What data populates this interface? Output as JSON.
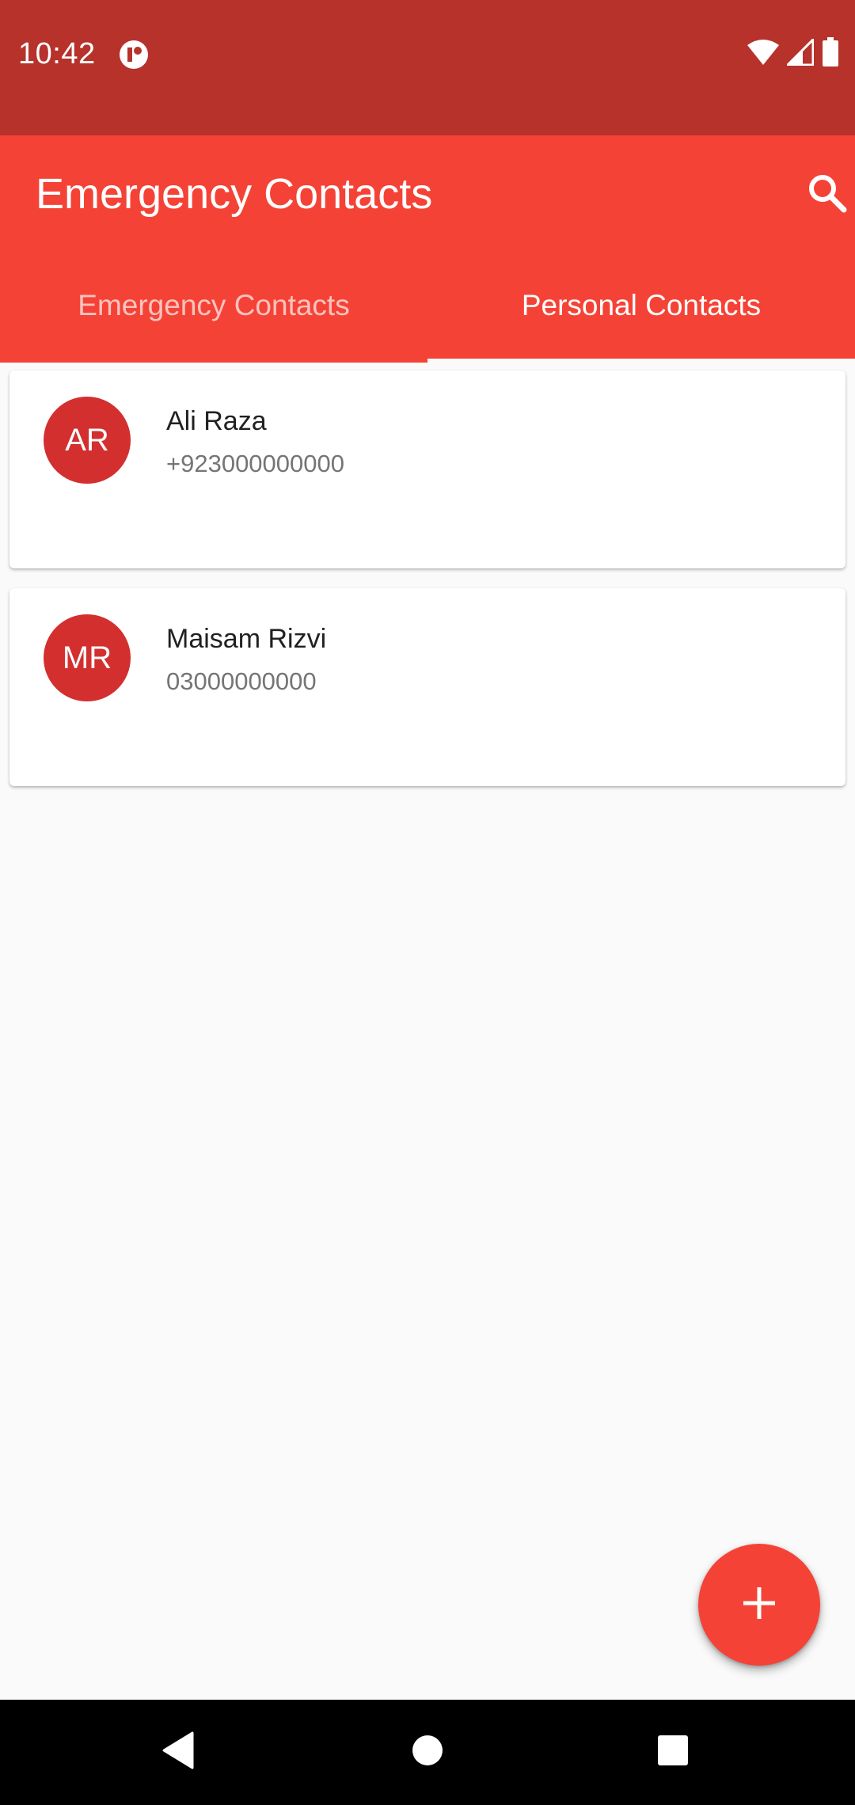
{
  "status_bar": {
    "time": "10:42",
    "icons": [
      "app-notification-icon",
      "wifi-icon",
      "signal-icon",
      "battery-icon"
    ]
  },
  "app_bar": {
    "title": "Emergency Contacts",
    "search_icon": "search-icon"
  },
  "tabs": [
    {
      "label": "Emergency Contacts",
      "active": false
    },
    {
      "label": "Personal Contacts",
      "active": true
    }
  ],
  "contacts": [
    {
      "initials": "AR",
      "name": "Ali Raza",
      "phone": "+923000000000"
    },
    {
      "initials": "MR",
      "name": "Maisam Rizvi",
      "phone": "03000000000"
    }
  ],
  "fab": {
    "icon": "plus-icon"
  },
  "nav_bar": {
    "icons": [
      "back-icon",
      "home-icon",
      "recents-icon"
    ]
  },
  "colors": {
    "status_bar": "#b6322b",
    "primary": "#f44336",
    "avatar": "#d32f2f",
    "background": "#fafafa"
  }
}
